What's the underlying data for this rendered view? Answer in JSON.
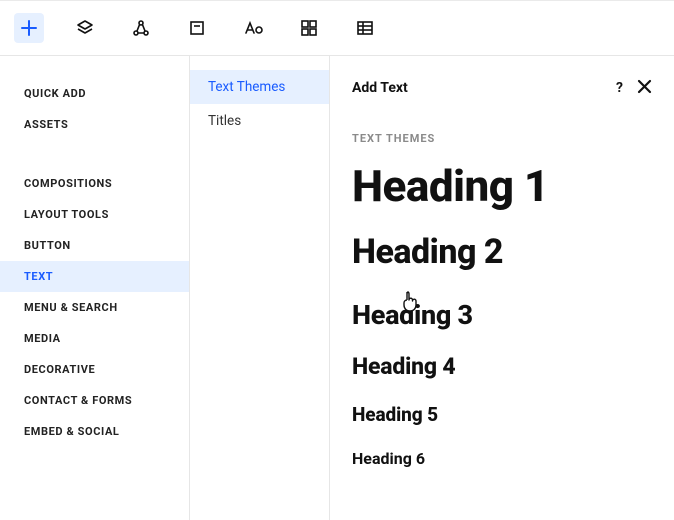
{
  "toolbar": {
    "icons": [
      "plus",
      "layers",
      "vector",
      "box",
      "text-tool",
      "grid",
      "table"
    ]
  },
  "sidebar": {
    "groups": [
      [
        {
          "label": "Quick Add"
        },
        {
          "label": "Assets"
        }
      ],
      [
        {
          "label": "Compositions"
        },
        {
          "label": "Layout Tools"
        },
        {
          "label": "Button"
        },
        {
          "label": "Text",
          "selected": true
        },
        {
          "label": "Menu & Search"
        },
        {
          "label": "Media"
        },
        {
          "label": "Decorative"
        },
        {
          "label": "Contact & Forms"
        },
        {
          "label": "Embed & Social"
        }
      ]
    ]
  },
  "sublist": {
    "items": [
      {
        "label": "Text Themes",
        "selected": true
      },
      {
        "label": "Titles"
      }
    ]
  },
  "panel": {
    "title": "Add Text",
    "section_label": "Text Themes",
    "headings": [
      {
        "label": "Heading 1",
        "size": "h1"
      },
      {
        "label": "Heading 2",
        "size": "h2"
      },
      {
        "label": "Heading 3",
        "size": "h3"
      },
      {
        "label": "Heading 4",
        "size": "h4"
      },
      {
        "label": "Heading 5",
        "size": "h5"
      },
      {
        "label": "Heading 6",
        "size": "h6"
      }
    ]
  }
}
